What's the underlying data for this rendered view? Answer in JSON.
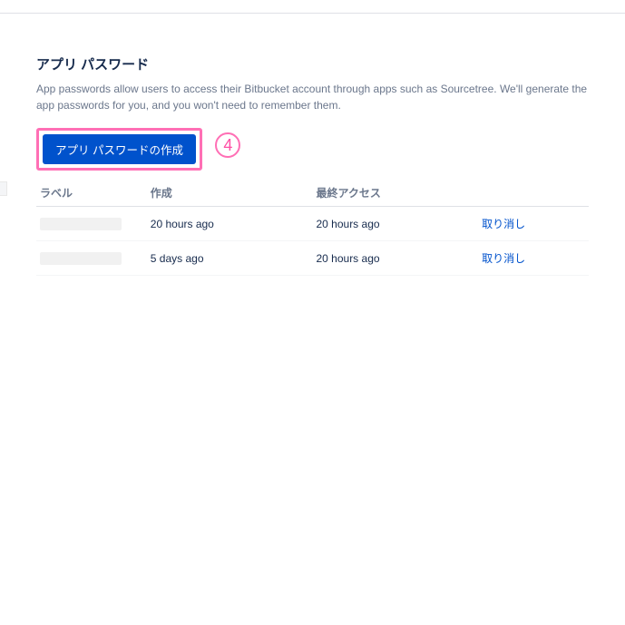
{
  "page": {
    "title": "アプリ パスワード",
    "description": "App passwords allow users to access their Bitbucket account through apps such as Sourcetree. We'll generate the app passwords for you, and you won't need to remember them."
  },
  "button": {
    "create_label": "アプリ パスワードの作成"
  },
  "annotation": {
    "step": "4"
  },
  "table": {
    "headers": {
      "label": "ラベル",
      "created": "作成",
      "last_access": "最終アクセス",
      "action": ""
    },
    "rows": [
      {
        "label": "",
        "created": "20 hours ago",
        "last_access": "20 hours ago",
        "revoke": "取り消し"
      },
      {
        "label": "",
        "created": "5 days ago",
        "last_access": "20 hours ago",
        "revoke": "取り消し"
      }
    ]
  }
}
